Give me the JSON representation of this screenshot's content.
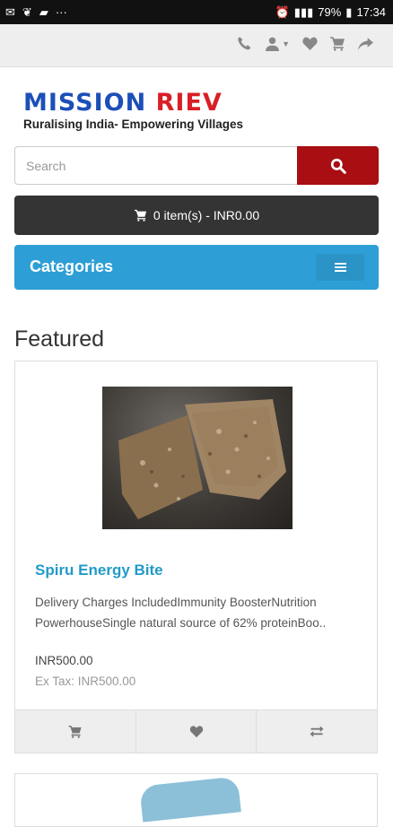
{
  "status_bar": {
    "battery": "79%",
    "time": "17:34"
  },
  "logo": {
    "word1": "MISSION",
    "word2": "RIEV",
    "tagline": "Ruralising India- Empowering Villages"
  },
  "search": {
    "placeholder": "Search"
  },
  "cart": {
    "label": "0 item(s) - INR0.00"
  },
  "categories": {
    "label": "Categories"
  },
  "section_title": "Featured",
  "product": {
    "name": "Spiru Energy Bite",
    "description": "Delivery Charges IncludedImmunity BoosterNutrition PowerhouseSingle natural source of 62% proteinBoo..",
    "price": "INR500.00",
    "ex_tax": "Ex Tax: INR500.00"
  },
  "icons": {
    "top": [
      "phone-icon",
      "user-icon",
      "heart-icon",
      "cart-icon",
      "share-icon"
    ],
    "card_buttons": [
      "add-to-cart-icon",
      "wishlist-icon",
      "compare-icon"
    ]
  },
  "colors": {
    "brand_blue": "#1c4fb7",
    "brand_red": "#d91f26",
    "accent": "#2d9fd6",
    "search_btn": "#a80e12"
  }
}
